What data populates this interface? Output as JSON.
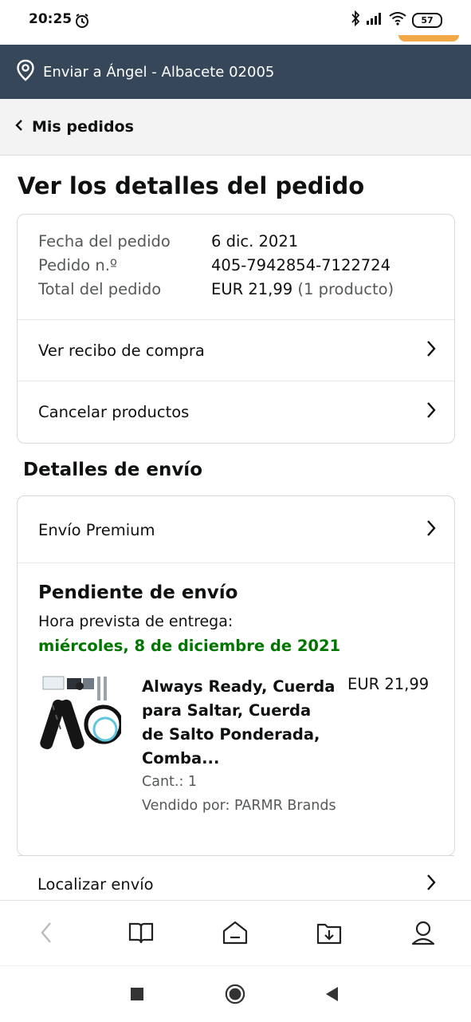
{
  "status_bar": {
    "time": "20:25",
    "battery": "57",
    "icons": [
      "alarm-icon",
      "bluetooth-icon",
      "signal-icon",
      "wifi-icon",
      "battery-icon"
    ]
  },
  "delivery": {
    "text": "Enviar a Ángel - Albacete 02005",
    "icon": "location-pin-icon"
  },
  "breadcrumb": {
    "label": "Mis pedidos"
  },
  "page": {
    "title": "Ver los detalles del pedido"
  },
  "order": {
    "fields": [
      {
        "label": "Fecha del pedido",
        "value": "6 dic. 2021"
      },
      {
        "label": "Pedido n.º",
        "value": "405-7942854-7122724"
      },
      {
        "label": "Total del pedido",
        "value": "EUR 21,99",
        "extra": "(1 producto)"
      }
    ],
    "actions": [
      {
        "label": "Ver recibo de compra"
      },
      {
        "label": "Cancelar productos"
      }
    ]
  },
  "shipping": {
    "section_title": "Detalles de envío",
    "method": "Envío Premium",
    "status": "Pendiente de envío",
    "eta_label": "Hora prevista de entrega:",
    "eta_date": "miércoles, 8 de diciembre de 2021",
    "product": {
      "title": "Always Ready, Cuerda para Saltar, Cuerda de Salto Ponderada, Comba...",
      "price": "EUR 21,99",
      "quantity": "Cant.: 1",
      "seller": "Vendido por: PARMR Brands"
    },
    "track_label": "Localizar envío"
  },
  "bottom_nav": {
    "items": [
      "back-icon",
      "book-icon",
      "home-icon",
      "download-icon",
      "profile-icon"
    ]
  },
  "system_nav": {
    "items": [
      "recents-icon",
      "home-circle-icon",
      "back-triangle-icon"
    ]
  },
  "colors": {
    "header_bg": "#37475a",
    "accent_orange": "#f3a847",
    "eta_green": "#007600"
  }
}
